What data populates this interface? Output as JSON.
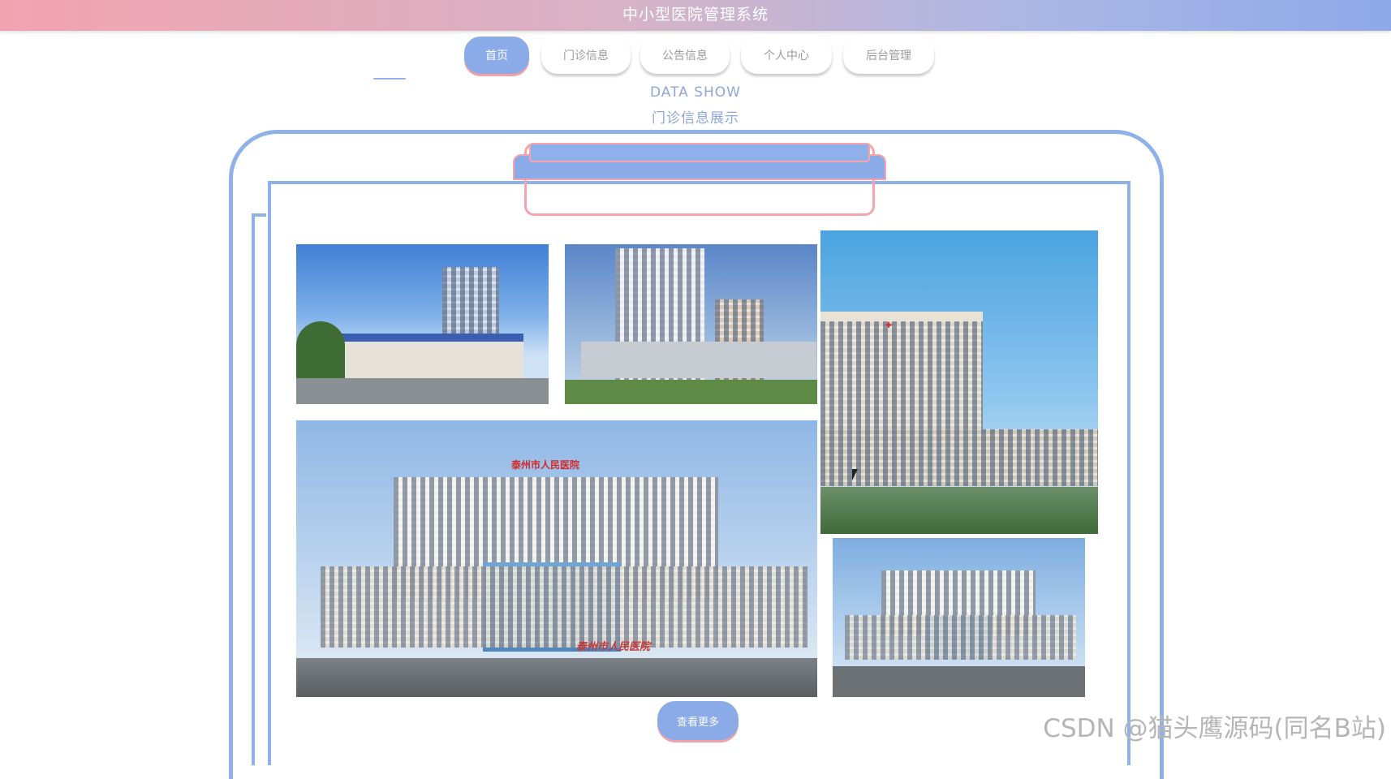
{
  "header": {
    "title": "中小型医院管理系统"
  },
  "nav": {
    "items": [
      {
        "label": "首页",
        "active": true
      },
      {
        "label": "门诊信息",
        "active": false
      },
      {
        "label": "公告信息",
        "active": false
      },
      {
        "label": "个人中心",
        "active": false
      },
      {
        "label": "后台管理",
        "active": false
      }
    ]
  },
  "section": {
    "title_en": "DATA SHOW",
    "title_zh": "门诊信息展示",
    "more_label": "查看更多"
  },
  "photos": {
    "p4_sign_top": "泰州市人民医院",
    "p4_sign_bottom": "泰州市人民医院"
  },
  "watermark": "CSDN @猫头鹰源码(同名B站)",
  "colors": {
    "accent_blue": "#8aaae8",
    "accent_pink": "#f4a0a8",
    "frame_blue": "#8fb0e8"
  }
}
